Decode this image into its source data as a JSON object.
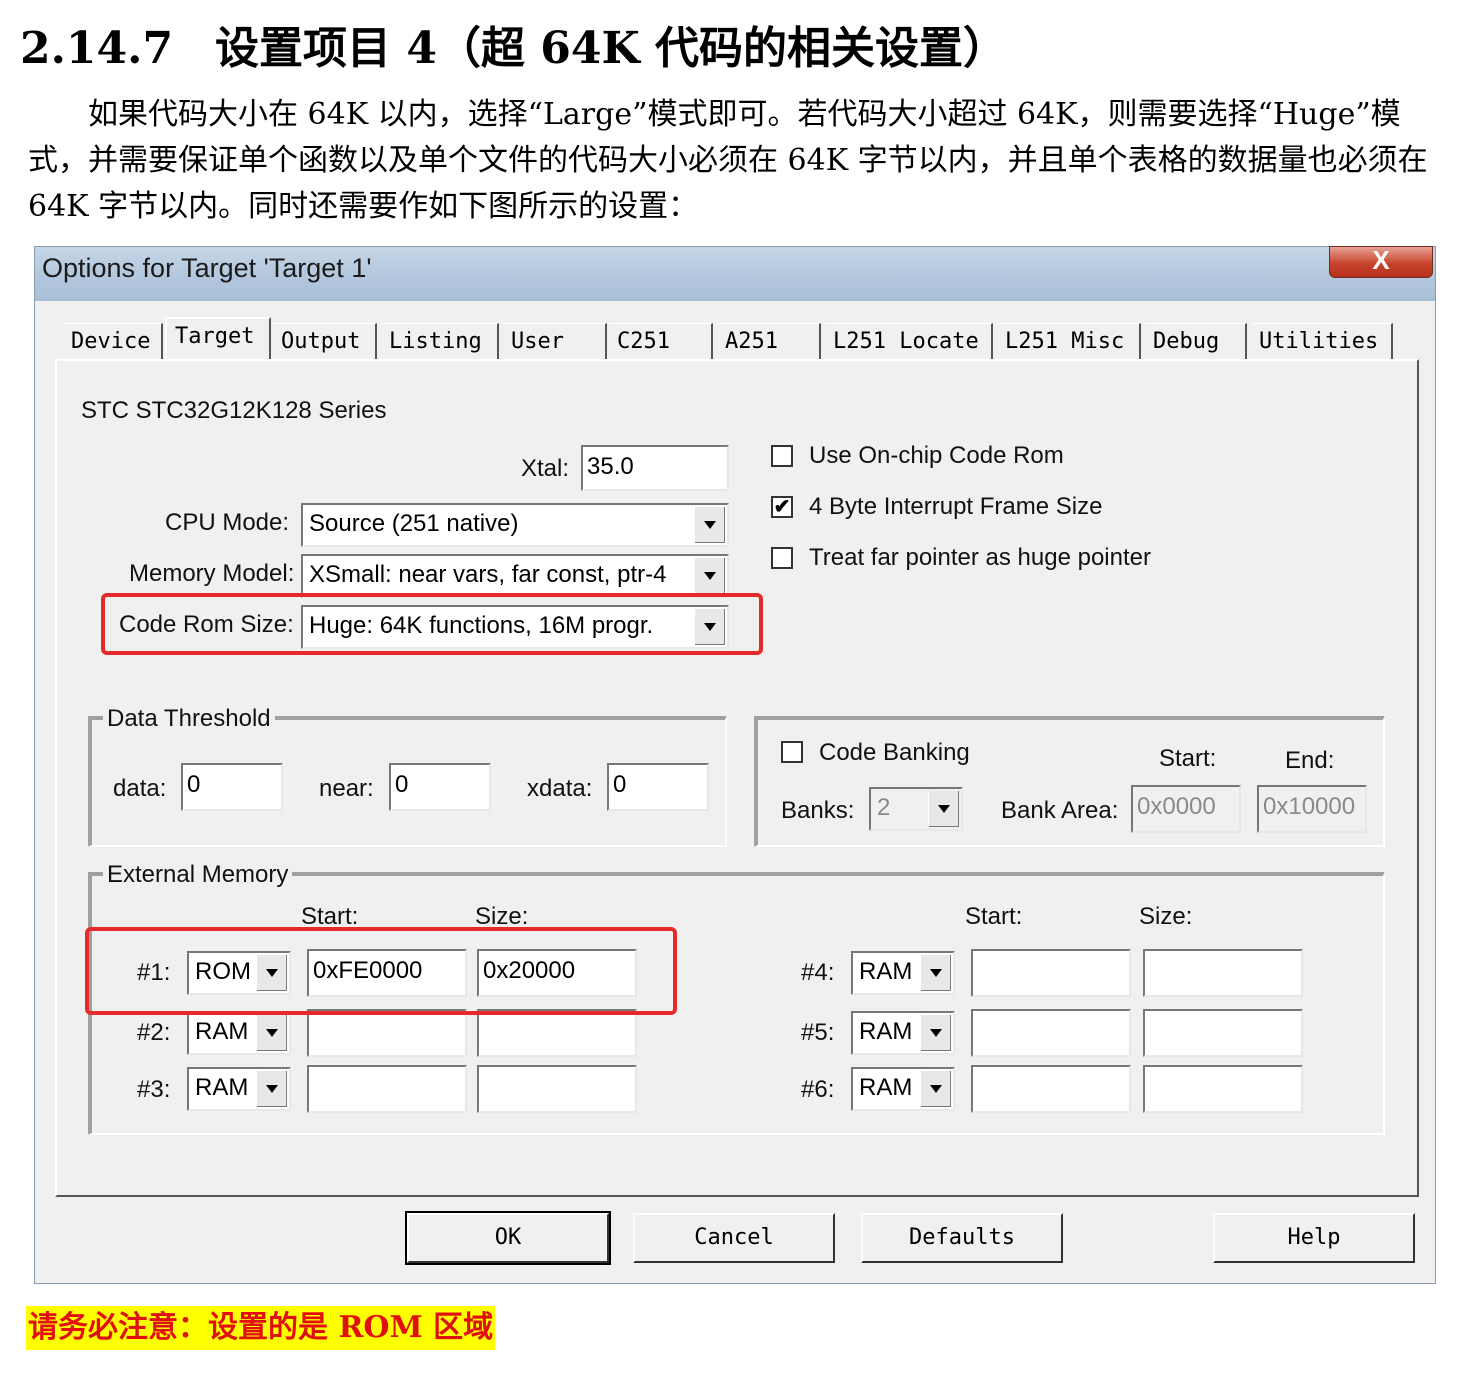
{
  "heading": {
    "number": "2.14.7",
    "title": "设置项目 4（超 64K 代码的相关设置）"
  },
  "paragraph": "如果代码大小在 64K 以内，选择“Large”模式即可。若代码大小超过 64K，则需要选择“Huge”模式，并需要保证单个函数以及单个文件的代码大小必须在 64K 字节以内，并且单个表格的数据量也必须在 64K 字节以内。同时还需要作如下图所示的设置：",
  "dialog": {
    "title": "Options for Target 'Target 1'",
    "close_label": "X",
    "tabs": [
      "Device",
      "Target",
      "Output",
      "Listing",
      "User",
      "C251",
      "A251",
      "L251 Locate",
      "L251 Misc",
      "Debug",
      "Utilities"
    ],
    "device_name": "STC STC32G12K128 Series",
    "xtal": {
      "label": "Xtal:",
      "value": "35.0"
    },
    "cpu_mode": {
      "label": "CPU Mode:",
      "value": "Source (251 native)"
    },
    "memory_model": {
      "label": "Memory Model:",
      "value": "XSmall: near vars, far const, ptr-4"
    },
    "code_rom_size": {
      "label": "Code Rom Size:",
      "value": "Huge: 64K functions, 16M progr."
    },
    "checkboxes": [
      {
        "label": "Use On-chip Code Rom",
        "checked": false
      },
      {
        "label": "4 Byte Interrupt Frame Size",
        "checked": true
      },
      {
        "label": "Treat far pointer as huge pointer",
        "checked": false
      }
    ],
    "check_mark": "✔",
    "data_threshold": {
      "legend": "Data Threshold",
      "data_label": "data:",
      "data_value": "0",
      "near_label": "near:",
      "near_value": "0",
      "xdata_label": "xdata:",
      "xdata_value": "0"
    },
    "code_banking": {
      "label": "Code Banking",
      "checked": false,
      "banks_label": "Banks:",
      "banks_value": "2",
      "bank_area_label": "Bank Area:",
      "start_label": "Start:",
      "start_value": "0x0000",
      "end_label": "End:",
      "end_value": "0x10000"
    },
    "external_memory": {
      "legend": "External Memory",
      "start_header": "Start:",
      "size_header": "Size:",
      "rows": [
        {
          "label": "#1:",
          "type": "ROM",
          "start": "0xFE0000",
          "size": "0x20000"
        },
        {
          "label": "#2:",
          "type": "RAM",
          "start": "",
          "size": ""
        },
        {
          "label": "#3:",
          "type": "RAM",
          "start": "",
          "size": ""
        },
        {
          "label": "#4:",
          "type": "RAM",
          "start": "",
          "size": ""
        },
        {
          "label": "#5:",
          "type": "RAM",
          "start": "",
          "size": ""
        },
        {
          "label": "#6:",
          "type": "RAM",
          "start": "",
          "size": ""
        }
      ]
    },
    "buttons": {
      "ok": "OK",
      "cancel": "Cancel",
      "defaults": "Defaults",
      "help": "Help"
    }
  },
  "note": "请务必注意：设置的是 ROM 区域",
  "colors": {
    "highlight_box": "#e52a2a",
    "note_background": "#ffff00",
    "note_text": "#e01010"
  }
}
